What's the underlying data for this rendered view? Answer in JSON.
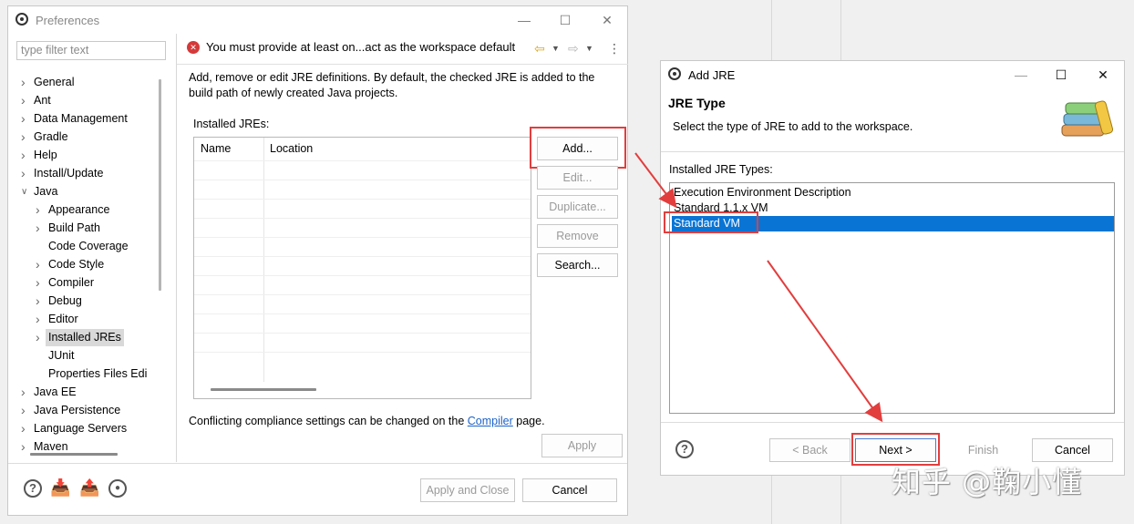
{
  "preferences": {
    "title": "Preferences",
    "filter_placeholder": "type filter text",
    "tree": [
      {
        "label": "General",
        "level": 0,
        "expandable": true
      },
      {
        "label": "Ant",
        "level": 0,
        "expandable": true
      },
      {
        "label": "Data Management",
        "level": 0,
        "expandable": true
      },
      {
        "label": "Gradle",
        "level": 0,
        "expandable": true
      },
      {
        "label": "Help",
        "level": 0,
        "expandable": true
      },
      {
        "label": "Install/Update",
        "level": 0,
        "expandable": true
      },
      {
        "label": "Java",
        "level": 0,
        "expandable": true,
        "expanded": true
      },
      {
        "label": "Appearance",
        "level": 1,
        "expandable": true
      },
      {
        "label": "Build Path",
        "level": 1,
        "expandable": true
      },
      {
        "label": "Code Coverage",
        "level": 1,
        "expandable": false
      },
      {
        "label": "Code Style",
        "level": 1,
        "expandable": true
      },
      {
        "label": "Compiler",
        "level": 1,
        "expandable": true
      },
      {
        "label": "Debug",
        "level": 1,
        "expandable": true
      },
      {
        "label": "Editor",
        "level": 1,
        "expandable": true
      },
      {
        "label": "Installed JREs",
        "level": 1,
        "expandable": true,
        "selected": true
      },
      {
        "label": "JUnit",
        "level": 1,
        "expandable": false
      },
      {
        "label": "Properties Files Edi",
        "level": 1,
        "expandable": false
      },
      {
        "label": "Java EE",
        "level": 0,
        "expandable": true
      },
      {
        "label": "Java Persistence",
        "level": 0,
        "expandable": true
      },
      {
        "label": "Language Servers",
        "level": 0,
        "expandable": true
      },
      {
        "label": "Maven",
        "level": 0,
        "expandable": true
      }
    ],
    "error_message": "You must provide at least on...act as the workspace default",
    "description": "Add, remove or edit JRE definitions. By default, the checked JRE is added to the build path of newly created Java projects.",
    "installed_label": "Installed JREs:",
    "table_columns": [
      "Name",
      "Location"
    ],
    "buttons": {
      "add": "Add...",
      "edit": "Edit...",
      "duplicate": "Duplicate...",
      "remove": "Remove",
      "search": "Search..."
    },
    "compliance_prefix": "Conflicting compliance settings can be changed on the",
    "compliance_link": "Compiler",
    "compliance_suffix": "page.",
    "apply": "Apply",
    "apply_close": "Apply and Close",
    "cancel": "Cancel"
  },
  "add_jre": {
    "title": "Add JRE",
    "heading": "JRE Type",
    "subheading": "Select the type of JRE to add to the workspace.",
    "list_label": "Installed JRE Types:",
    "types": [
      "Execution Environment Description",
      "Standard 1.1.x VM",
      "Standard VM"
    ],
    "selected_type": "Standard VM",
    "back": "< Back",
    "next": "Next >",
    "finish": "Finish",
    "cancel": "Cancel"
  },
  "watermark": "知乎 @鞠小懂",
  "colors": {
    "annotation_red": "#e23e3e",
    "selection_blue": "#0a74d4",
    "link_blue": "#1c63c7"
  }
}
